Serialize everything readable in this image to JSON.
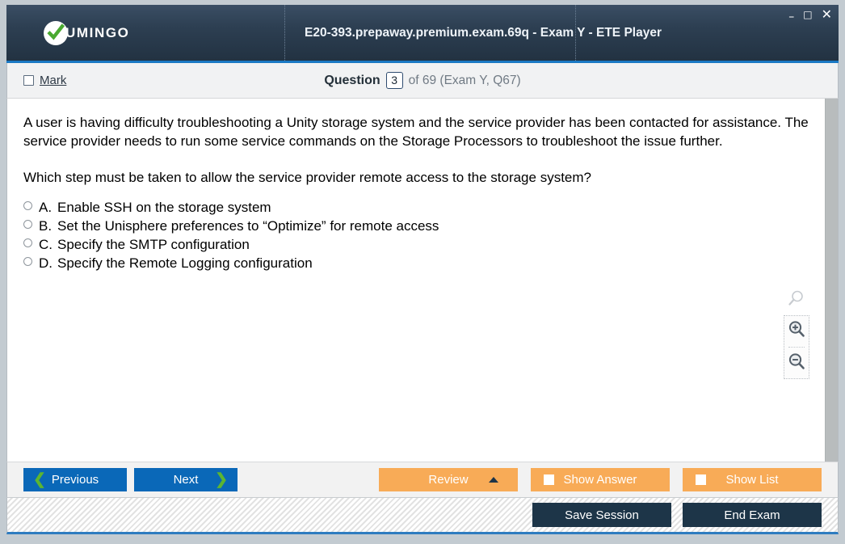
{
  "window": {
    "logo_text": "UMINGO",
    "logo_icon": "check-circle-icon",
    "title": "E20-393.prepaway.premium.exam.69q - Exam Y - ETE Player",
    "controls": {
      "minimize": "–",
      "maximize": "□",
      "close": "✕"
    }
  },
  "infobar": {
    "mark_label_prefix": "",
    "mark_label": "Mark",
    "question_label": "Question",
    "question_number": "3",
    "question_of": "of 69 (Exam Y, Q67)"
  },
  "question": {
    "body": "A user is having difficulty troubleshooting a Unity storage system and the service provider has been contacted for assistance. The service provider needs to run some service commands on the Storage Processors to troubleshoot the issue further.",
    "prompt": "Which step must be taken to allow the service provider remote access to the storage system?",
    "options": [
      {
        "letter": "A.",
        "text": "Enable SSH on the storage system"
      },
      {
        "letter": "B.",
        "text": "Set the Unisphere preferences to “Optimize” for remote access"
      },
      {
        "letter": "C.",
        "text": "Specify the SMTP configuration"
      },
      {
        "letter": "D.",
        "text": "Specify the Remote Logging configuration"
      }
    ]
  },
  "zoom_tools": {
    "reset": "magnifier-icon",
    "zoom_in": "zoom-in-icon",
    "zoom_out": "zoom-out-icon"
  },
  "buttons": {
    "previous": "Previous",
    "next": "Next",
    "review": "Review",
    "show_answer": "Show Answer",
    "show_list": "Show List",
    "save_session": "Save Session",
    "end_exam": "End Exam"
  },
  "colors": {
    "header_navy": "#2d3f52",
    "accent_blue": "#1b79c4",
    "button_blue": "#0a68b8",
    "chevron_green": "#5cb531",
    "orange": "#f8ab57",
    "navy_button": "#1d3548"
  }
}
